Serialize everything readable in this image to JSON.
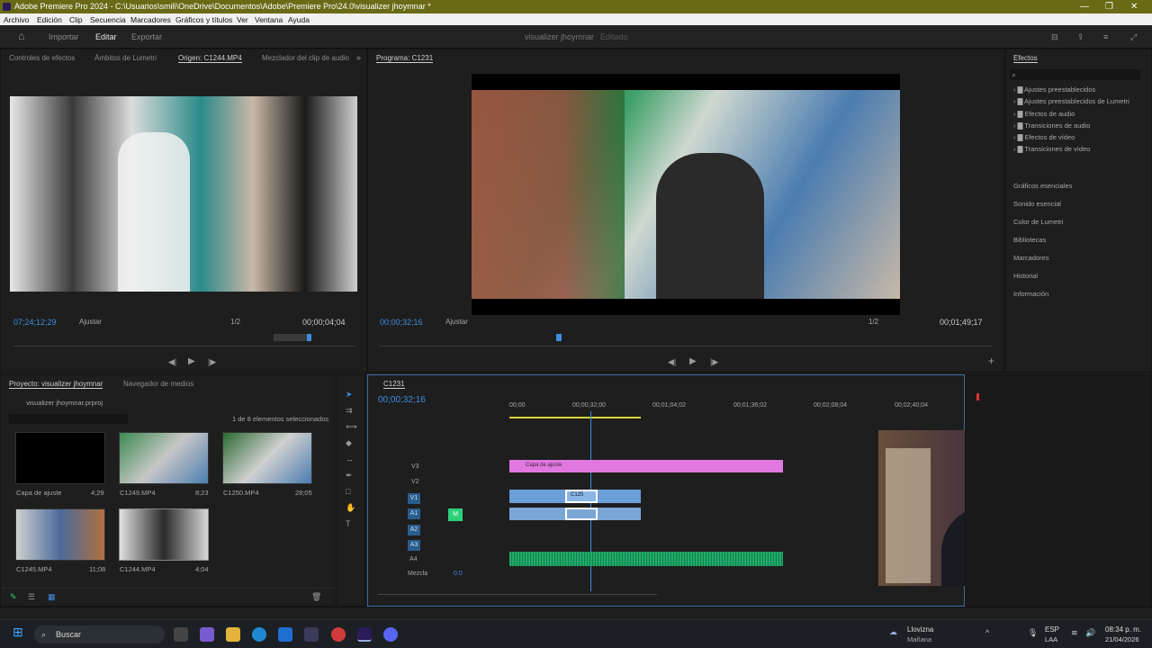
{
  "window": {
    "title": "Adobe Premiere Pro 2024 - C:\\Usuarios\\smili\\OneDrive\\Documentos\\Adobe\\Premiere Pro\\24.0\\visualizer jhoymnar *"
  },
  "menu": [
    "Archivo",
    "Edición",
    "Clip",
    "Secuencia",
    "Marcadores",
    "Gráficos y títulos",
    "Ver",
    "Ventana",
    "Ayuda"
  ],
  "workspace": {
    "tabs": [
      "Importar",
      "Editar",
      "Exportar"
    ],
    "project_name": "visualizer jhoymnar",
    "status": "Editado"
  },
  "source_panel": {
    "tabs": [
      "Controles de efectos",
      "Ámbitos de Lumetri",
      "Origen: C1244.MP4",
      "Mezclador del clip de audio"
    ],
    "timecode": "07;24;12;29",
    "fit": "Ajustar",
    "resolution": "1/2",
    "duration": "00;00;04;04"
  },
  "program_panel": {
    "title": "Programa: C1231",
    "timecode": "00;00;32;16",
    "fit": "Ajustar",
    "resolution": "1/2",
    "duration": "00;01;49;17"
  },
  "effects_panel": {
    "title": "Efectos",
    "tree": [
      "Ajustes preestablecidos",
      "Ajustes preestablecidos de Lumetri",
      "Efectos de audio",
      "Transiciones de audio",
      "Efectos de vídeo",
      "Transiciones de vídeo"
    ],
    "sections": [
      "Gráficos esenciales",
      "Sonido esencial",
      "Color de Lumetri",
      "Bibliotecas",
      "Marcadores",
      "Historial",
      "Información"
    ]
  },
  "project_panel": {
    "tabs": [
      "Proyecto: visualizer jhoymnar",
      "Navegador de medios"
    ],
    "file": "visualizer jhoymnar.prproj",
    "selection": "1 de 8 elementos seleccionados",
    "items": [
      {
        "name": "Capa de ajuste",
        "duration": "4;29"
      },
      {
        "name": "C1249.MP4",
        "duration": "8;23"
      },
      {
        "name": "C1250.MP4",
        "duration": "28;05"
      },
      {
        "name": "C1245.MP4",
        "duration": "11;08"
      },
      {
        "name": "C1244.MP4",
        "duration": "4;04"
      }
    ]
  },
  "timeline": {
    "sequence": "C1231",
    "timecode": "00;00;32;16",
    "ruler": [
      "00;00",
      "00;00;32;00",
      "00;01;04;02",
      "00;01;36;02",
      "00;02;08;04",
      "00;02;40;04"
    ],
    "video_tracks": [
      "V3",
      "V2",
      "V1"
    ],
    "audio_tracks": [
      "A1",
      "A2",
      "A3",
      "A4"
    ],
    "mix_label": "Mezcla",
    "mix_value": "0.0",
    "adjust_clip": "Capa de ajuste",
    "v1_clip_label": "C125"
  },
  "taskbar": {
    "search": "Buscar",
    "weather_location": "Lloviznа",
    "weather_time": "Mañana",
    "lang": "ESP",
    "lang2": "LAA",
    "time": "08:34 p. m.",
    "date": "21/04/2026"
  },
  "colors": {
    "accent": "#3e8ee0",
    "adjustment_clip": "#e078e0",
    "video_clip": "#6a9fd8",
    "audio_clip": "#1faa6a",
    "titlebar": "#6a6a16"
  }
}
